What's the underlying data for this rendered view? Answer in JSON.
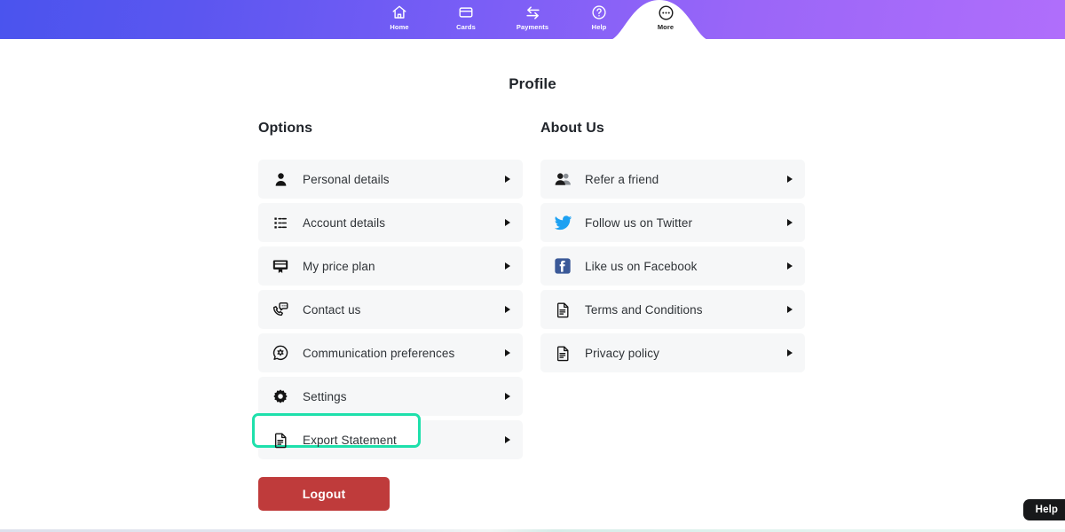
{
  "navbar": {
    "gradient_from": "#4a54ee",
    "gradient_to": "#b06efb",
    "items": [
      {
        "label": "Home",
        "icon": "home-icon",
        "active": false
      },
      {
        "label": "Cards",
        "icon": "card-icon",
        "active": false
      },
      {
        "label": "Payments",
        "icon": "transfer-icon",
        "active": false
      },
      {
        "label": "Help",
        "icon": "question-circle-icon",
        "active": false
      },
      {
        "label": "More",
        "icon": "ellipsis-circle-icon",
        "active": true
      }
    ]
  },
  "page": {
    "title": "Profile"
  },
  "options": {
    "heading": "Options",
    "items": [
      {
        "label": "Personal details",
        "icon": "person-icon",
        "highlighted": false
      },
      {
        "label": "Account details",
        "icon": "list-icon",
        "highlighted": false
      },
      {
        "label": "My price plan",
        "icon": "price-plan-icon",
        "highlighted": false
      },
      {
        "label": "Contact us",
        "icon": "phone-chat-icon",
        "highlighted": false
      },
      {
        "label": "Communication preferences",
        "icon": "chat-gear-icon",
        "highlighted": false
      },
      {
        "label": "Settings",
        "icon": "gear-icon",
        "highlighted": false
      },
      {
        "label": "Export Statement",
        "icon": "document-icon",
        "highlighted": true
      }
    ]
  },
  "about_us": {
    "heading": "About Us",
    "items": [
      {
        "label": "Refer a friend",
        "icon": "two-people-icon",
        "color": "#1b1b1b"
      },
      {
        "label": "Follow us on Twitter",
        "icon": "twitter-icon",
        "color": "#1da1f2"
      },
      {
        "label": "Like us on Facebook",
        "icon": "facebook-icon",
        "color": "#3b5998"
      },
      {
        "label": "Terms and Conditions",
        "icon": "document-icon",
        "color": "#1b1b1b"
      },
      {
        "label": "Privacy policy",
        "icon": "document-icon",
        "color": "#1b1b1b"
      }
    ]
  },
  "logout": {
    "label": "Logout",
    "color": "#bf3b3b"
  },
  "help_widget": {
    "label": "Help"
  },
  "highlight": {
    "color": "#1ee0ab"
  }
}
